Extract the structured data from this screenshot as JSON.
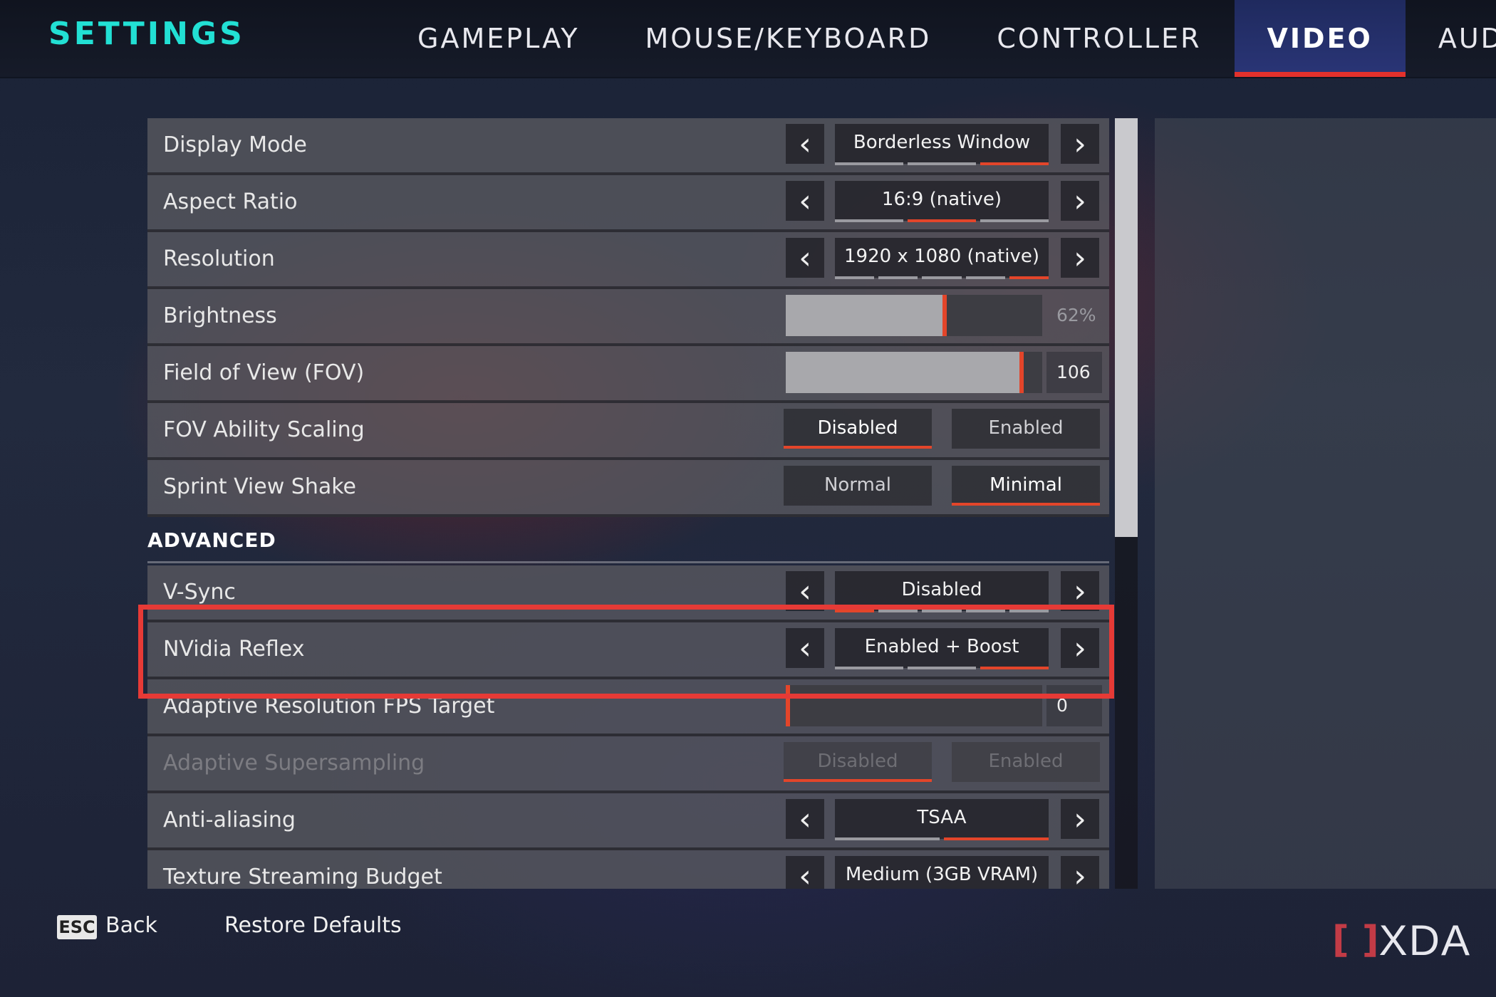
{
  "header": {
    "title": "SETTINGS",
    "tabs": [
      {
        "label": "GAMEPLAY",
        "active": false
      },
      {
        "label": "MOUSE/KEYBOARD",
        "active": false
      },
      {
        "label": "CONTROLLER",
        "active": false
      },
      {
        "label": "VIDEO",
        "active": true
      },
      {
        "label": "AUDIO",
        "active": false
      }
    ]
  },
  "settings": {
    "display_mode": {
      "label": "Display Mode",
      "value": "Borderless Window",
      "pips": 3,
      "selected_pip": 3
    },
    "aspect_ratio": {
      "label": "Aspect Ratio",
      "value": "16:9 (native)",
      "pips": 3,
      "selected_pip": 2
    },
    "resolution": {
      "label": "Resolution",
      "value": "1920 x 1080 (native)",
      "pips": 5,
      "selected_pip": 5
    },
    "brightness": {
      "label": "Brightness",
      "value": "62%",
      "level": 0.62
    },
    "fov": {
      "label": "Field of View (FOV)",
      "value": "106",
      "level": 0.92
    },
    "fov_ability_scaling": {
      "label": "FOV Ability Scaling",
      "options": [
        "Disabled",
        "Enabled"
      ],
      "selected": "Disabled"
    },
    "sprint_view_shake": {
      "label": "Sprint View Shake",
      "options": [
        "Normal",
        "Minimal"
      ],
      "selected": "Minimal"
    }
  },
  "advanced": {
    "heading": "ADVANCED",
    "vsync": {
      "label": "V-Sync",
      "value": "Disabled",
      "pips": 5,
      "selected_pip": 1
    },
    "nvidia_reflex": {
      "label": "NVidia Reflex",
      "value": "Enabled + Boost",
      "pips": 3,
      "selected_pip": 3
    },
    "adaptive_fps": {
      "label": "Adaptive Resolution FPS Target",
      "value": "0",
      "level": 0.0
    },
    "adaptive_supersampling": {
      "label": "Adaptive Supersampling",
      "options": [
        "Disabled",
        "Enabled"
      ],
      "selected": "Disabled",
      "disabled": true
    },
    "anti_aliasing": {
      "label": "Anti-aliasing",
      "value": "TSAA",
      "pips": 2,
      "selected_pip": 2
    },
    "texture_budget": {
      "label": "Texture Streaming Budget",
      "value": "Medium (3GB VRAM)"
    }
  },
  "footer": {
    "esc_key": "ESC",
    "back_label": "Back",
    "restore_label": "Restore Defaults"
  },
  "watermark": {
    "bracket": "[ ]",
    "text": "XDA"
  },
  "colors": {
    "accent": "#e3452a",
    "title": "#22e0d4",
    "highlight": "#e63a36"
  },
  "icons": {
    "prev": "chevron-left-icon",
    "next": "chevron-right-icon"
  }
}
